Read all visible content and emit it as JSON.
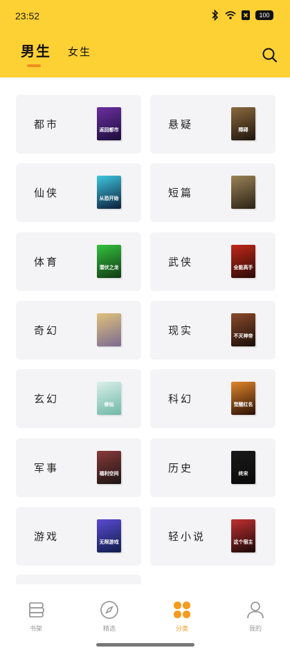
{
  "status": {
    "time": "23:52",
    "battery": "100"
  },
  "tabs": {
    "male": "男生",
    "female": "女生"
  },
  "categories": [
    {
      "label": "都市",
      "cover_text": "返回都市",
      "cover_colors": [
        "#6b2fa0",
        "#1c0d3a"
      ]
    },
    {
      "label": "悬疑",
      "cover_text": "障碍",
      "cover_colors": [
        "#8a6a3e",
        "#1e140c"
      ]
    },
    {
      "label": "仙侠",
      "cover_text": "从恐开始",
      "cover_colors": [
        "#3ec7e0",
        "#0b1e3a"
      ]
    },
    {
      "label": "短篇",
      "cover_text": "",
      "cover_colors": [
        "#9a8356",
        "#2b2216"
      ]
    },
    {
      "label": "体育",
      "cover_text": "潜伏之龙",
      "cover_colors": [
        "#35c13f",
        "#0f3a12"
      ]
    },
    {
      "label": "武侠",
      "cover_text": "全能高手",
      "cover_colors": [
        "#c2281b",
        "#2a0a06"
      ]
    },
    {
      "label": "奇幻",
      "cover_text": "",
      "cover_colors": [
        "#e0c27a",
        "#7a6a93"
      ]
    },
    {
      "label": "现实",
      "cover_text": "不灭神帝",
      "cover_colors": [
        "#8a4a2a",
        "#1a0e0a"
      ]
    },
    {
      "label": "玄幻",
      "cover_text": "修仙",
      "cover_colors": [
        "#d9efe8",
        "#6fb8a8"
      ]
    },
    {
      "label": "科幻",
      "cover_text": "觉醒红名",
      "cover_colors": [
        "#e0862a",
        "#2a0f06"
      ]
    },
    {
      "label": "军事",
      "cover_text": "福利空间",
      "cover_colors": [
        "#8a3a3a",
        "#1a1414"
      ]
    },
    {
      "label": "历史",
      "cover_text": "终宋",
      "cover_colors": [
        "#1a1a1a",
        "#0a0a0a"
      ]
    },
    {
      "label": "游戏",
      "cover_text": "无限游戏",
      "cover_colors": [
        "#5a4ad0",
        "#0f1d4a"
      ]
    },
    {
      "label": "轻小说",
      "cover_text": "这个宿主",
      "cover_colors": [
        "#c03030",
        "#1a0808"
      ]
    }
  ],
  "nav": {
    "bookshelf": "书架",
    "featured": "精选",
    "category": "分类",
    "mine": "我的"
  },
  "colors": {
    "brand": "#fdd034",
    "accent": "#f59b1e",
    "indicator": "#f08f1d"
  }
}
